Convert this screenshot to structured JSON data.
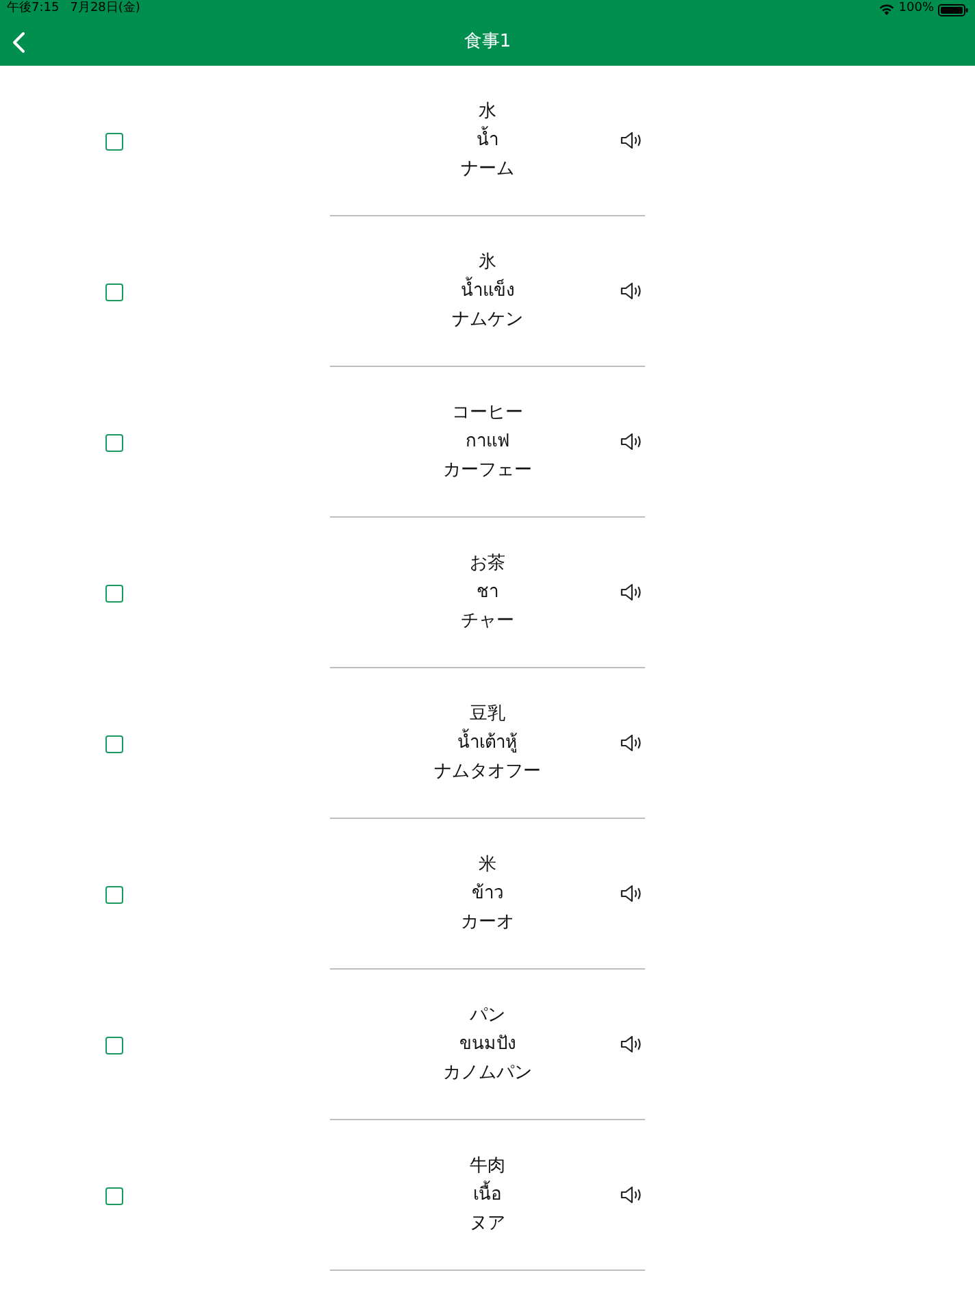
{
  "status_bar": {
    "time": "午後7:15",
    "date": "7月28日(金)",
    "battery": "100%"
  },
  "nav": {
    "title": "食事1"
  },
  "items": [
    {
      "japanese": "水",
      "thai": "น้ำ",
      "reading": "ナーム",
      "checked": false
    },
    {
      "japanese": "氷",
      "thai": "น้ำแข็ง",
      "reading": "ナムケン",
      "checked": false
    },
    {
      "japanese": "コーヒー",
      "thai": "กาแฟ",
      "reading": "カーフェー",
      "checked": false
    },
    {
      "japanese": "お茶",
      "thai": "ชา",
      "reading": "チャー",
      "checked": false
    },
    {
      "japanese": "豆乳",
      "thai": "น้ำเต้าหู้",
      "reading": "ナムタオフー",
      "checked": false
    },
    {
      "japanese": "米",
      "thai": "ข้าว",
      "reading": "カーオ",
      "checked": false
    },
    {
      "japanese": "パン",
      "thai": "ขนมปัง",
      "reading": "カノムパン",
      "checked": false
    },
    {
      "japanese": "牛肉",
      "thai": "เนื้อ",
      "reading": "ヌア",
      "checked": false
    }
  ]
}
